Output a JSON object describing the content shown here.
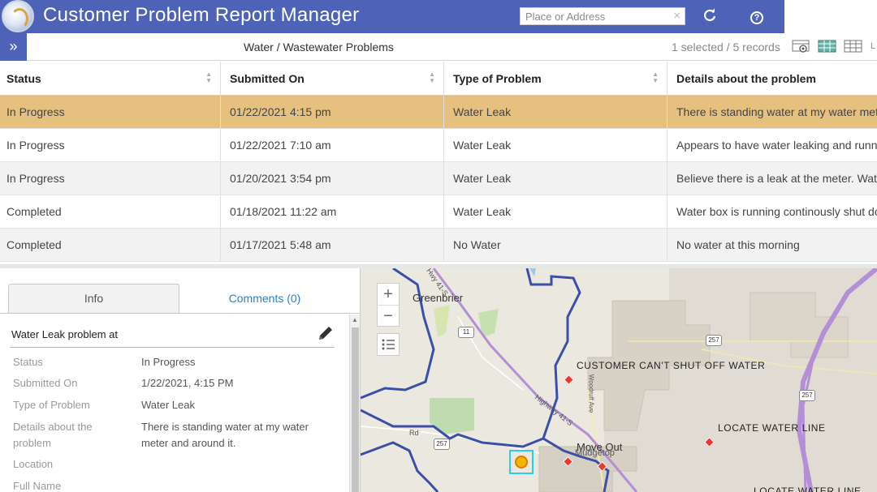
{
  "header": {
    "title": "Customer Problem Report Manager",
    "search_placeholder": "Place or Address",
    "clear_glyph": "×",
    "refresh_glyph": "⟳",
    "help_glyph": "?"
  },
  "table_toolbar": {
    "expand_glyph": "»",
    "layer_title": "Water / Wastewater Problems",
    "record_count": "1 selected / 5 records"
  },
  "table": {
    "columns": [
      "Status",
      "Submitted On",
      "Type of Problem",
      "Details about the problem"
    ],
    "rows": [
      [
        "In Progress",
        "01/22/2021 4:15 pm",
        "Water Leak",
        "There is standing water at my water meter and around it."
      ],
      [
        "In Progress",
        "01/22/2021 7:10 am",
        "Water Leak",
        "Appears to have water leaking and running"
      ],
      [
        "In Progress",
        "01/20/2021 3:54 pm",
        "Water Leak",
        "Believe there is a leak at the meter. Water"
      ],
      [
        "Completed",
        "01/18/2021 11:22 am",
        "Water Leak",
        "Water box is running continously shut down"
      ],
      [
        "Completed",
        "01/17/2021 5:48 am",
        "No Water",
        "No water at this morning"
      ]
    ],
    "selected_row": 0,
    "selected_color": "#e5c07f"
  },
  "details": {
    "tab_info": "Info",
    "tab_comments": "Comments (0)",
    "feature_title": "Water Leak problem at",
    "attributes": {
      "status_label": "Status",
      "status_value": "In Progress",
      "submitted_label": "Submitted On",
      "submitted_value": "1/22/2021, 4:15 PM",
      "type_label": "Type of Problem",
      "type_value": "Water Leak",
      "details_label": "Details about the problem",
      "details_value": "There is standing water at my water meter and around it.",
      "location_label": "Location",
      "fullname_label": "Full Name"
    }
  },
  "map": {
    "zoom_in": "+",
    "zoom_out": "−",
    "labels": {
      "greenbrier": "Greenbrier",
      "shutoff": "CUSTOMER CAN'T SHUT OFF WATER",
      "locate": "LOCATE WATER LINE",
      "locate_partial": "LOCATE WATER LINE",
      "moveout": "Move Out",
      "mudgetop": "Mudgetop",
      "highway": "Highway 41-S",
      "highway_top": "Hwy 41-S",
      "woodruff": "Woodruff Ave",
      "rd": "Rd",
      "shield_11": "11",
      "shield_257a": "257",
      "shield_257b": "257",
      "shield_257c": "257"
    },
    "colors": {
      "boundary": "#3c4fa8",
      "highway": "#b48fd6",
      "marker": "#e63b2e",
      "selection": "#29d0e8",
      "brand": "#4e63b8"
    }
  }
}
